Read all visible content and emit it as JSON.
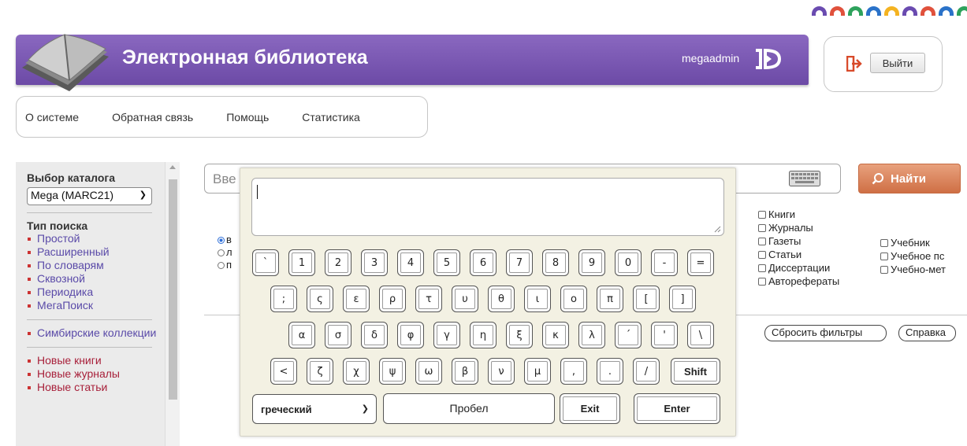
{
  "colors": {
    "header_purple": "#7655b2",
    "search_orange": "#d97a50",
    "link_purple": "#5a4aa8",
    "link_red": "#a8203a",
    "arc_colors": [
      "#6a4bb0",
      "#e0513c",
      "#2ea25c",
      "#2a72c9",
      "#f4b321",
      "#6a4bb0",
      "#e0513c",
      "#2a72c9",
      "#2ea25c",
      "#e0513c"
    ]
  },
  "header": {
    "title": "Электронная библиотека",
    "username": "megaadmin",
    "logout_label": "Выйти"
  },
  "topnav": [
    "О системе",
    "Обратная связь",
    "Помощь",
    "Статистика"
  ],
  "sidebar": {
    "catalog_heading": "Выбор каталога",
    "catalog_value": "Mega (MARC21)",
    "search_type_heading": "Тип поиска",
    "search_types": [
      "Простой",
      "Расширенный",
      "По словарям",
      "Сквозной",
      "Периодика",
      "МегаПоиск"
    ],
    "collections": [
      "Симбирские коллекции"
    ],
    "new_items": [
      "Новые книги",
      "Новые журналы",
      "Новые статьи"
    ]
  },
  "search": {
    "placeholder": "Вве",
    "button_label": "Найти"
  },
  "radios": [
    {
      "label": "в",
      "selected": true
    },
    {
      "label": "л",
      "selected": false
    },
    {
      "label": "п",
      "selected": false
    }
  ],
  "doc_types_col1": [
    "Книги",
    "Журналы",
    "Газеты",
    "Статьи",
    "Диссертации",
    "Автореферат"
  ],
  "doc_types_col2": [
    "Учебник",
    "Учебное пс",
    "Учебно-мет"
  ],
  "doc_types_col1_last": "Автореферат",
  "filters": {
    "reset_label": "Сбросить фильтры",
    "help_label": "Справка"
  },
  "keyboard": {
    "row1": [
      "`",
      "1",
      "2",
      "3",
      "4",
      "5",
      "6",
      "7",
      "8",
      "9",
      "0",
      "-",
      "="
    ],
    "row2": [
      ";",
      "ς",
      "ε",
      "ρ",
      "τ",
      "υ",
      "θ",
      "ι",
      "ο",
      "π",
      "[",
      "]"
    ],
    "row3": [
      "α",
      "σ",
      "δ",
      "φ",
      "γ",
      "η",
      "ξ",
      "κ",
      "λ",
      "΄",
      "'",
      "\\"
    ],
    "row4": [
      "<",
      "ζ",
      "χ",
      "ψ",
      "ω",
      "β",
      "ν",
      "μ",
      ",",
      ".",
      "/"
    ],
    "shift_label": "Shift",
    "language": "греческий",
    "space_label": "Пробел",
    "exit_label": "Exit",
    "enter_label": "Enter"
  }
}
